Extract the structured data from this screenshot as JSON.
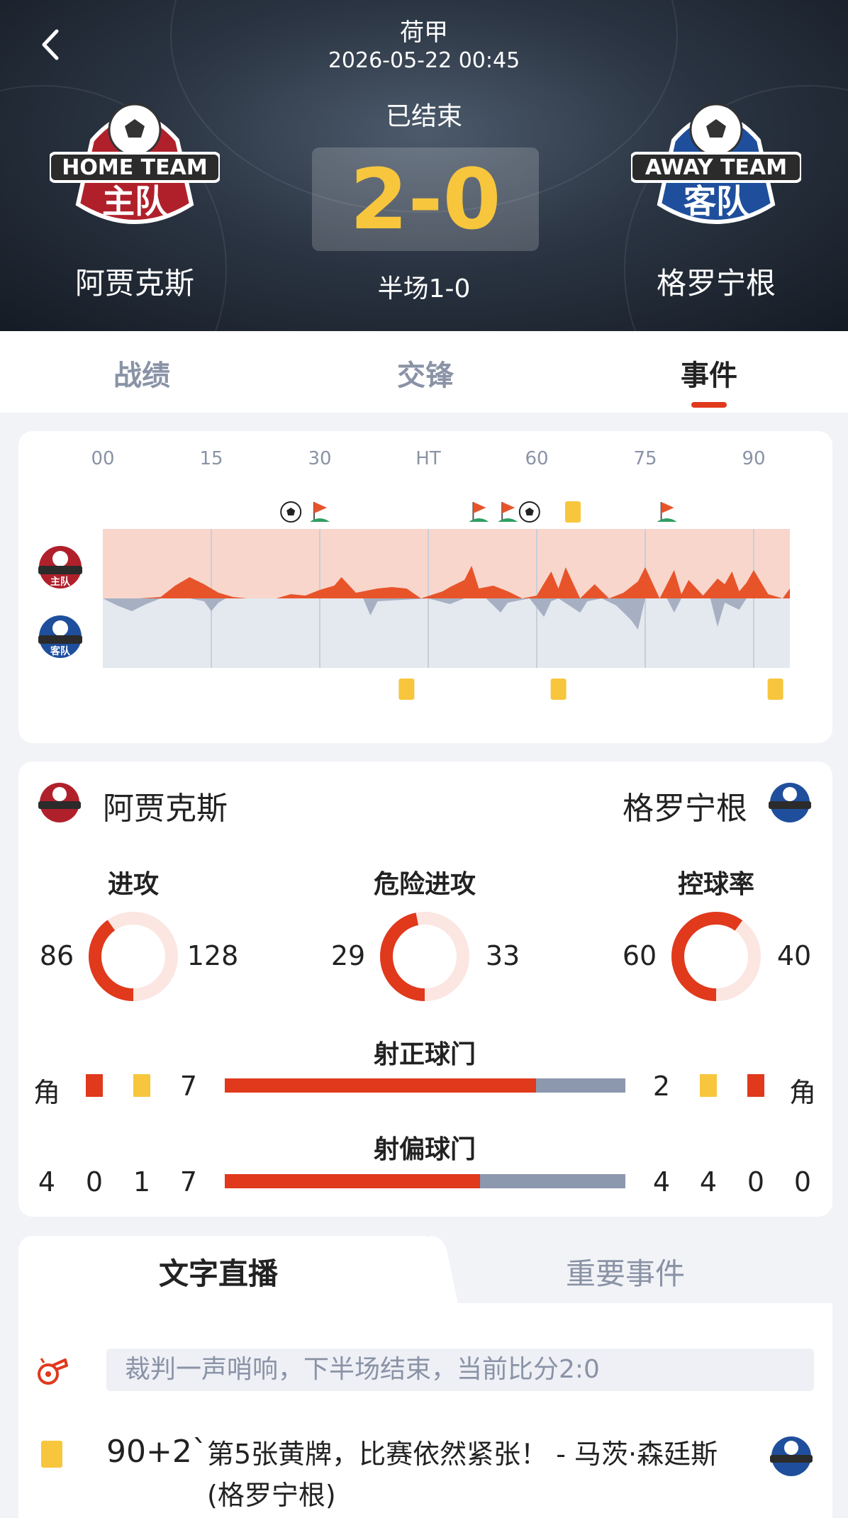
{
  "header": {
    "league": "荷甲",
    "datetime": "2026-05-22 00:45",
    "status": "已结束",
    "score": "2-0",
    "halftime": "半场1-0",
    "home_team": "阿贾克斯",
    "away_team": "格罗宁根",
    "home_crest_text": [
      "HOME TEAM",
      "主队"
    ],
    "away_crest_text": [
      "AWAY TEAM",
      "客队"
    ]
  },
  "tabs": [
    "战绩",
    "交锋",
    "事件"
  ],
  "active_tab": "事件",
  "timeline": {
    "labels": [
      "00",
      "15",
      "30",
      "HT",
      "60",
      "75",
      "90"
    ],
    "colors": {
      "home": "#e8542a",
      "home_bg": "#f8d6cc",
      "away": "#a6b0c2",
      "away_bg": "#e4e8ef"
    },
    "home_events": [
      {
        "minute": 26,
        "icon": "goal"
      },
      {
        "minute": 30,
        "icon": "corner-flag"
      },
      {
        "minute": 52,
        "icon": "corner-flag"
      },
      {
        "minute": 56,
        "icon": "corner-flag"
      },
      {
        "minute": 59,
        "icon": "goal"
      },
      {
        "minute": 65,
        "icon": "yellow-card"
      },
      {
        "minute": 78,
        "icon": "corner-flag"
      }
    ],
    "away_events": [
      {
        "minute": 42,
        "icon": "yellow-card"
      },
      {
        "minute": 63,
        "icon": "yellow-card"
      },
      {
        "minute": 93,
        "icon": "yellow-card"
      }
    ]
  },
  "stats": {
    "home_team": "阿贾克斯",
    "away_team": "格罗宁根",
    "rings": [
      {
        "title": "进攻",
        "home": "86",
        "away": "128"
      },
      {
        "title": "危险进攻",
        "home": "29",
        "away": "33"
      },
      {
        "title": "控球率",
        "home": "60",
        "away": "40"
      }
    ],
    "shots_on": {
      "title": "射正球门",
      "home": "7",
      "away": "2"
    },
    "shots_off": {
      "title": "射偏球门",
      "home": "7",
      "away": "4"
    },
    "home_icons": {
      "corner_label": "角",
      "corners": "4",
      "red": "0",
      "yellow": "1"
    },
    "away_icons": {
      "corner_label": "角",
      "corners": "0",
      "red": "0",
      "yellow": "4"
    },
    "colors": {
      "home": "#e0391c",
      "away": "#8c98ae",
      "yellow": "#f7c63d",
      "ring_bg": "#fbe6e1"
    }
  },
  "live": {
    "tabs": [
      "文字直播",
      "重要事件"
    ],
    "ticker": "裁判一声哨响，下半场结束，当前比分2:0",
    "event_time": "90+2`",
    "event_text": "第5张黄牌，比赛依然紧张！ - 马茨·森廷斯(格罗宁根)"
  }
}
